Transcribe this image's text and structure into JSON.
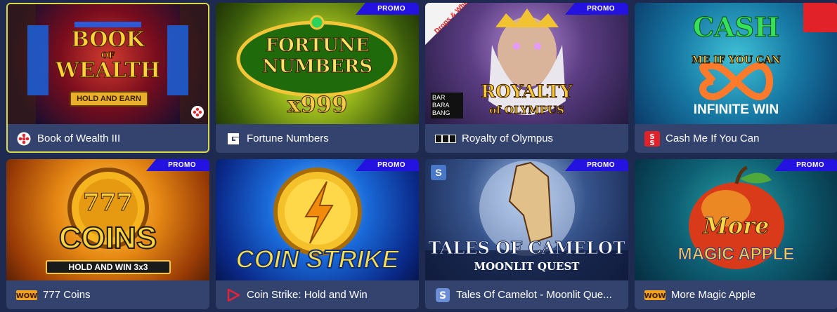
{
  "games": [
    {
      "name": "Book of Wealth III",
      "provider_icon": "dots-provider-icon",
      "promo": false,
      "selected": true,
      "logo_lines": [
        "BOOK",
        "OF",
        "WEALTH",
        "HOLD AND EARN"
      ]
    },
    {
      "name": "Fortune Numbers",
      "provider_icon": "g-provider-icon",
      "promo": true,
      "selected": false,
      "logo_lines": [
        "FORTUNE",
        "NUMBERS",
        "x999"
      ]
    },
    {
      "name": "Royalty of Olympus",
      "provider_icon": "bar-provider-icon",
      "promo": true,
      "selected": false,
      "logo_lines": [
        "ROYALTY",
        "of OLYMPUS",
        "Drops & Wheels",
        "BAR BARA BANG"
      ]
    },
    {
      "name": "Cash Me If You Can",
      "provider_icon": "s-provider-icon",
      "promo": false,
      "selected": false,
      "logo_lines": [
        "CASH",
        "ME IF YOU CAN",
        "INFINITE WIN"
      ]
    },
    {
      "name": "777 Coins",
      "provider_icon": "wow-provider-icon",
      "promo": true,
      "selected": false,
      "logo_lines": [
        "777",
        "COINS",
        "HOLD AND WIN 3x3"
      ]
    },
    {
      "name": "Coin Strike: Hold and Win",
      "provider_icon": "play-provider-icon",
      "promo": true,
      "selected": false,
      "logo_lines": [
        "COIN STRIKE"
      ]
    },
    {
      "name": "Tales Of Camelot - Moonlit Que...",
      "provider_icon": "s-blue-provider-icon",
      "promo": true,
      "selected": false,
      "logo_lines": [
        "TALES OF CAMELOT",
        "MOONLIT QUEST"
      ]
    },
    {
      "name": "More Magic Apple",
      "provider_icon": "wow-provider-icon",
      "promo": true,
      "selected": false,
      "logo_lines": [
        "More",
        "MAGIC APPLE"
      ]
    }
  ],
  "promo_label": "PROMO"
}
